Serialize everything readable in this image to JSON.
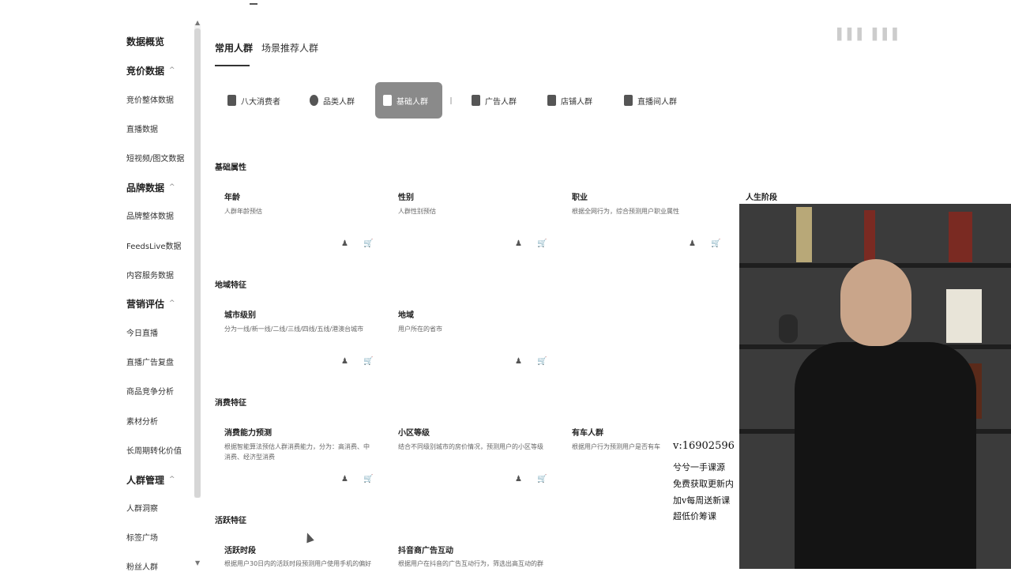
{
  "sidebar": {
    "items": [
      {
        "label": "数据概览",
        "group": true,
        "chevron": ""
      },
      {
        "label": "竞价数据",
        "group": true,
        "chevron": "^"
      },
      {
        "label": "竞价整体数据",
        "group": false,
        "chevron": ""
      },
      {
        "label": "直播数据",
        "group": false,
        "chevron": ""
      },
      {
        "label": "短视频/图文数据",
        "group": false,
        "chevron": ""
      },
      {
        "label": "品牌数据",
        "group": true,
        "chevron": "^"
      },
      {
        "label": "品牌整体数据",
        "group": false,
        "chevron": ""
      },
      {
        "label": "FeedsLive数据",
        "group": false,
        "chevron": ""
      },
      {
        "label": "内容服务数据",
        "group": false,
        "chevron": ""
      },
      {
        "label": "营销评估",
        "group": true,
        "chevron": "^"
      },
      {
        "label": "今日直播",
        "group": false,
        "chevron": ""
      },
      {
        "label": "直播广告复盘",
        "group": false,
        "chevron": ""
      },
      {
        "label": "商品竞争分析",
        "group": false,
        "chevron": ""
      },
      {
        "label": "素材分析",
        "group": false,
        "chevron": ""
      },
      {
        "label": "长周期转化价值",
        "group": false,
        "chevron": ""
      },
      {
        "label": "人群管理",
        "group": true,
        "chevron": "^"
      },
      {
        "label": "人群洞察",
        "group": false,
        "chevron": ""
      },
      {
        "label": "标签广场",
        "group": false,
        "chevron": ""
      },
      {
        "label": "粉丝人群",
        "group": false,
        "chevron": ""
      }
    ]
  },
  "tabs": [
    {
      "label": "常用人群",
      "active": true
    },
    {
      "label": "场景推荐人群",
      "active": false
    }
  ],
  "categories": [
    {
      "label": "八大消费者",
      "active": false,
      "icon": "consumer-icon"
    },
    {
      "label": "品类人群",
      "active": false,
      "icon": "category-icon"
    },
    {
      "label": "基础人群",
      "active": true,
      "icon": "user-icon"
    },
    {
      "label": "广告人群",
      "active": false,
      "icon": "ad-icon"
    },
    {
      "label": "店铺人群",
      "active": false,
      "icon": "shop-icon"
    },
    {
      "label": "直播间人群",
      "active": false,
      "icon": "live-icon"
    }
  ],
  "sections": [
    {
      "title": "基础属性",
      "cards": [
        {
          "title": "年龄",
          "desc": "人群年龄预估"
        },
        {
          "title": "性别",
          "desc": "人群性别预估"
        },
        {
          "title": "职业",
          "desc": "根据全网行为，综合预测用户职业属性"
        },
        {
          "title": "人生阶段",
          "desc": ""
        }
      ]
    },
    {
      "title": "地域特征",
      "cards": [
        {
          "title": "城市级别",
          "desc": "分为一线/新一线/二线/三线/四线/五线/港澳台城市"
        },
        {
          "title": "地域",
          "desc": "用户所在的省市"
        }
      ]
    },
    {
      "title": "消费特征",
      "cards": [
        {
          "title": "消费能力预测",
          "desc": "根据智能算法预估人群消费能力，分为：高消费、中消费、经济型消费"
        },
        {
          "title": "小区等级",
          "desc": "结合不同级别城市的房价情况，预测用户的小区等级"
        },
        {
          "title": "有车人群",
          "desc": "根据用户行为预测用户是否有车"
        }
      ]
    },
    {
      "title": "活跃特征",
      "cards": [
        {
          "title": "活跃时段",
          "desc": "根据用户30日内的活跃时段预测用户使用手机的偏好"
        },
        {
          "title": "抖音商广告互动",
          "desc": "根据用户在抖音的广告互动行为，筛选出高互动的群"
        }
      ]
    }
  ],
  "watermark": {
    "contact": "v:16902596",
    "lines": [
      "兮兮一手课源",
      "免费获取更新内",
      "加v每周送新课",
      "超低价筹课"
    ]
  },
  "icons": {
    "person": "person-icon",
    "cart": "cart-icon"
  }
}
